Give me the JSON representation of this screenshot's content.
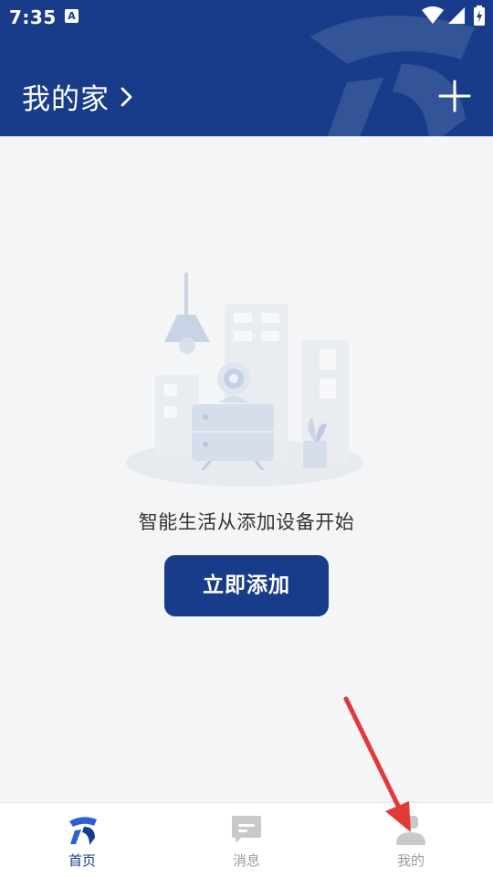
{
  "status_bar": {
    "time": "7:35",
    "notification_icon": "A"
  },
  "header": {
    "title": "我的家",
    "add_icon": "plus-icon"
  },
  "empty_state": {
    "message": "智能生活从添加设备开始",
    "button_label": "立即添加"
  },
  "tab_bar": {
    "tabs": [
      {
        "label": "首页",
        "icon": "home-logo-icon",
        "active": true
      },
      {
        "label": "消息",
        "icon": "message-icon",
        "active": false
      },
      {
        "label": "我的",
        "icon": "profile-icon",
        "active": false
      }
    ]
  },
  "colors": {
    "primary": "#183c8a",
    "background": "#f4f5f7",
    "annotation_arrow": "#e23a3a"
  }
}
